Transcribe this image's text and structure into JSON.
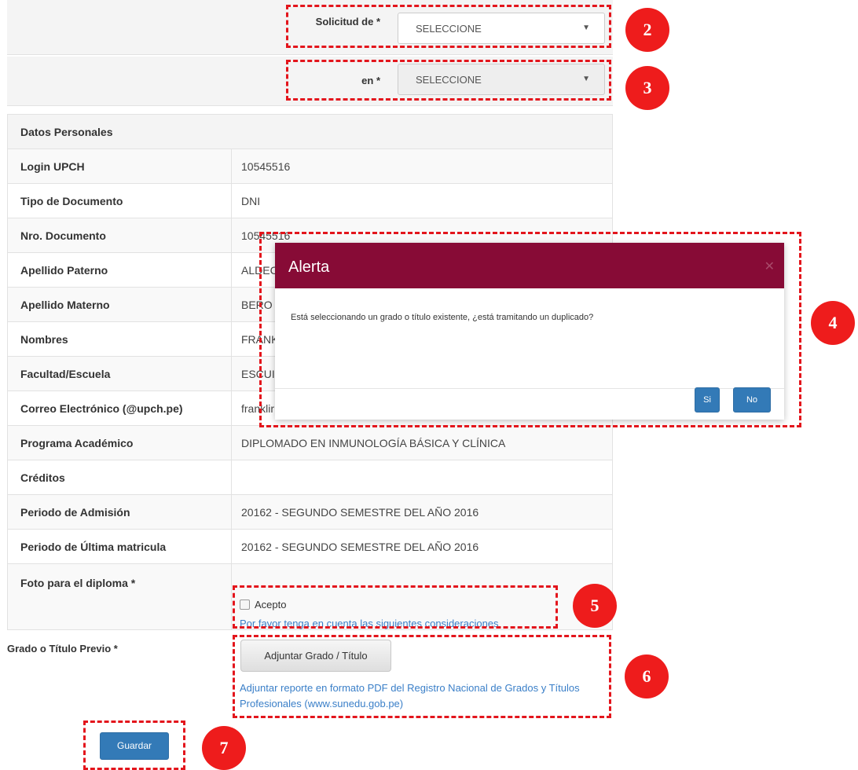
{
  "form": {
    "solicitud_label": "Solicitud de *",
    "solicitud_value": "SELECCIONE",
    "en_label": "en *",
    "en_value": "SELECCIONE"
  },
  "datos": {
    "header": "Datos Personales",
    "rows": [
      {
        "label": "Login UPCH",
        "value": "10545516"
      },
      {
        "label": "Tipo de Documento",
        "value": "DNI"
      },
      {
        "label": "Nro. Documento",
        "value": "10545516"
      },
      {
        "label": "Apellido Paterno",
        "value": "ALDEC"
      },
      {
        "label": "Apellido Materno",
        "value": "BERO"
      },
      {
        "label": "Nombres",
        "value": "FRANK"
      },
      {
        "label": "Facultad/Escuela",
        "value": "ESCUI"
      },
      {
        "label": "Correo Electrónico (@upch.pe)",
        "value": "franklir"
      },
      {
        "label": "Programa Académico",
        "value": "DIPLOMADO EN INMUNOLOGÍA BÁSICA Y CLÍNICA"
      },
      {
        "label": "Créditos",
        "value": ""
      },
      {
        "label": "Periodo de Admisión",
        "value": "20162 - SEGUNDO SEMESTRE DEL AÑO 2016"
      },
      {
        "label": "Periodo de Última matricula",
        "value": "20162 - SEGUNDO SEMESTRE DEL AÑO 2016"
      },
      {
        "label": "Foto para el diploma *",
        "value": ""
      }
    ]
  },
  "acepto": {
    "label": "Acepto",
    "link": "Por favor tenga en cuenta las siguientes consideraciones"
  },
  "grado": {
    "label": "Grado o Título Previo *",
    "button": "Adjuntar Grado / Título",
    "note": "Adjuntar reporte en formato PDF del Registro Nacional de Grados y Títulos Profesionales (www.sunedu.gob.pe)"
  },
  "guardar": "Guardar",
  "modal": {
    "title": "Alerta",
    "message": "Está seleccionando un grado o título existente, ¿está tramitando un duplicado?",
    "yes": "Si",
    "no": "No"
  },
  "markers": [
    "2",
    "3",
    "4",
    "5",
    "6",
    "7"
  ],
  "icons": {
    "caret": "caret-down-icon",
    "close": "close-icon",
    "checkbox": "checkbox-unchecked-icon"
  },
  "colors": {
    "modal_header": "#870b36",
    "primary_button": "#337ab7",
    "link": "#3a7fc8",
    "annotation": "#ee1c1c"
  }
}
